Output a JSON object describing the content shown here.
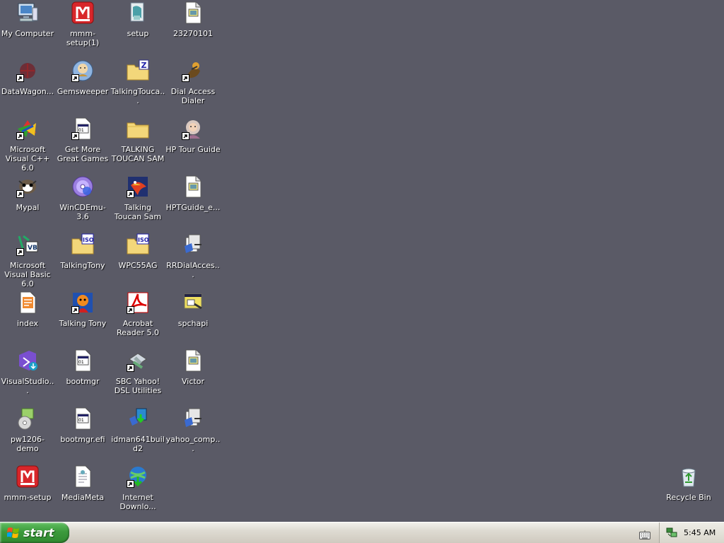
{
  "desktop": {
    "icons": [
      {
        "label": "My Computer",
        "icon": "my-computer-icon",
        "shortcut": false
      },
      {
        "label": "mmm-setup(1)",
        "icon": "mmm-setup-icon",
        "shortcut": false
      },
      {
        "label": "setup",
        "icon": "setup-icon",
        "shortcut": false
      },
      {
        "label": "23270101",
        "icon": "document-icon",
        "shortcut": false
      },
      {
        "label": "DataWagon...",
        "icon": "datawagon-icon",
        "shortcut": true
      },
      {
        "label": "Gemsweeper",
        "icon": "gemsweeper-icon",
        "shortcut": true
      },
      {
        "label": "TalkingTouca...",
        "icon": "zip-folder-icon",
        "shortcut": false
      },
      {
        "label": "Dial Access Dialer",
        "icon": "dialer-icon",
        "shortcut": true
      },
      {
        "label": "Microsoft Visual C++ 6.0",
        "icon": "visual-cpp-icon",
        "shortcut": true
      },
      {
        "label": "Get More Great Games",
        "icon": "games-doc-icon",
        "shortcut": true
      },
      {
        "label": "TALKING TOUCAN SAM",
        "icon": "folder-icon",
        "shortcut": false
      },
      {
        "label": "HP Tour Guide",
        "icon": "hp-tour-guide-icon",
        "shortcut": true
      },
      {
        "label": "Mypal",
        "icon": "mypal-icon",
        "shortcut": true
      },
      {
        "label": "WinCDEmu-3.6",
        "icon": "wincdemu-icon",
        "shortcut": false
      },
      {
        "label": "Talking Toucan Sam",
        "icon": "toucan-icon",
        "shortcut": true
      },
      {
        "label": "HPTGuide_e...",
        "icon": "document-icon",
        "shortcut": false
      },
      {
        "label": "Microsoft Visual Basic 6.0",
        "icon": "visual-basic-icon",
        "shortcut": true
      },
      {
        "label": "TalkingTony",
        "icon": "iso-folder-icon",
        "shortcut": false
      },
      {
        "label": "WPC55AG",
        "icon": "iso-folder-icon",
        "shortcut": false
      },
      {
        "label": "RRDialAcces...",
        "icon": "installer-icon",
        "shortcut": false
      },
      {
        "label": "index",
        "icon": "html-file-icon",
        "shortcut": false
      },
      {
        "label": "Talking Tony",
        "icon": "tony-tiger-icon",
        "shortcut": true
      },
      {
        "label": "Acrobat Reader 5.0",
        "icon": "acrobat-icon",
        "shortcut": true
      },
      {
        "label": "spchapi",
        "icon": "setup-program-icon",
        "shortcut": false
      },
      {
        "label": "VisualStudio...",
        "icon": "visual-studio-icon",
        "shortcut": false
      },
      {
        "label": "bootmgr",
        "icon": "system-file-icon",
        "shortcut": false
      },
      {
        "label": "SBC Yahoo! DSL Utilities",
        "icon": "dsl-utilities-icon",
        "shortcut": true
      },
      {
        "label": "Victor",
        "icon": "document-icon",
        "shortcut": false
      },
      {
        "label": "pw1206-demo",
        "icon": "cd-installer-icon",
        "shortcut": false
      },
      {
        "label": "bootmgr.efi",
        "icon": "system-file-icon",
        "shortcut": false
      },
      {
        "label": "idman641build2",
        "icon": "idm-installer-icon",
        "shortcut": false
      },
      {
        "label": "yahoo_comp...",
        "icon": "installer-icon",
        "shortcut": false
      },
      {
        "label": "mmm-setup",
        "icon": "mmm-setup-icon",
        "shortcut": false
      },
      {
        "label": "MediaMeta",
        "icon": "text-file-icon",
        "shortcut": false
      },
      {
        "label": "Internet Downlo...",
        "icon": "internet-download-icon",
        "shortcut": true
      }
    ],
    "recycle_bin": {
      "label": "Recycle Bin",
      "icon": "recycle-bin-icon"
    }
  },
  "taskbar": {
    "start_label": "start",
    "clock": "5:45 AM",
    "colors": {
      "desktop": "#5a5a66",
      "start": "#3c9a3c"
    }
  }
}
